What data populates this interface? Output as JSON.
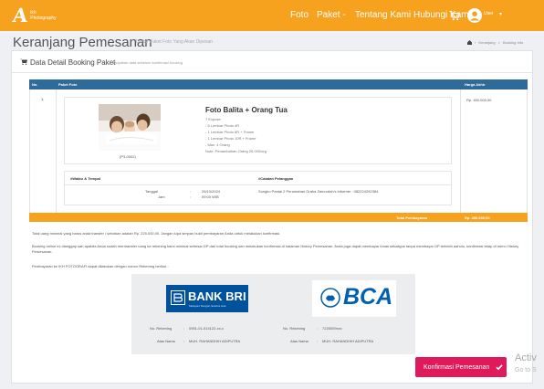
{
  "navbar": {
    "logo_mark": "A",
    "logo_line1": "ikh",
    "logo_line2": "Photography",
    "links": [
      "Foto",
      "Paket -",
      "Tentang Kami",
      "Hubungi Kami"
    ],
    "user_label": "User",
    "caret": "▾",
    "color": "#f6a21e"
  },
  "header": {
    "title": "Keranjang Pemesanan",
    "subtitle": "Daftar Paket Foto Yang Akan Dipesan",
    "breadcrumb": [
      "Keranjang",
      ">",
      "Booking Info"
    ]
  },
  "card": {
    "title": "Data Detail Booking Paket",
    "title_sub": "Lanjutkan data sebelum konfirmasi booking"
  },
  "table": {
    "headers": {
      "no": "No.",
      "paket": "Paket Foto",
      "harga": "Harga Akhir"
    },
    "row": {
      "no": "1.",
      "harga": "Rp. 450.000,00"
    },
    "header_color": "#2e6b9b"
  },
  "package": {
    "code": "(P3-0002)",
    "name": "Foto Balita + Orang Tua",
    "details": [
      "7 Expose",
      "- 5 Lembar Photo 4R",
      "- 1 Lembar Photo 6R + Frame",
      "- 1 Lembar Photo 10R + Frame",
      "- Max. 4 Orang",
      "Note: Penambahan Orang 25.000/org"
    ]
  },
  "schedule": {
    "waktu_header": "#Waktu & Tempat",
    "catatan_header": "#Catatan Pelanggan",
    "tanggal_label": "Tanggal",
    "jam_label": "Jam",
    "separator": ":",
    "tanggal": "26/10/2024",
    "jam": "09:00 WIB",
    "catatan": "Songko Pantai 2 Perumahan Graha Zamrudah's informer : 082224292384"
  },
  "total": {
    "label": "Total Pembayaran",
    "value": "Rp. 450.000,00",
    "color": "#f6a21e"
  },
  "notes": {
    "p1": "Total uang minimal yang harus anda transfer / setorkan adalah Rp. 225.000,00. Jangan lupa simpan bukti pembayaran Anda untuk melakukan konfirmasi.",
    "p2": "Booking online ini dianggap sah apabila Anda sudah mentransfer uang ke rekening kami minimal sebesar DP dari total booking dan melakukan konfirmasi di halaman History Pemesanan. Anda juga dapat membayar lunas sekaligus tanpa membayar DP terlebih dahulu, konfirmasi tetap di menu History Pemesanan.",
    "p3": "Pembayaran ke IKH FOTOGRAFI dapat dilakukan dengan nomor Rekening berikut :"
  },
  "banks": [
    {
      "name": "BANK BRI",
      "tagline": "Melayani Dengan Setulus Hati",
      "rek_label": "No. Rekening",
      "rek": "0951-01-014122-xx-x",
      "nama_label": "Atas Nama",
      "nama": "MUH. RAHANDHIH ADIPUTRA",
      "color": "#00529c"
    },
    {
      "name": "BCA",
      "rek_label": "No. Rekening",
      "rek": "7225009xxx",
      "nama_label": "Atas Nama",
      "nama": "MUH. RAHANDHIH ADIPUTRA",
      "color": "#0060af"
    }
  ],
  "confirm_button": {
    "label": "Konfirmasi Pemesanan",
    "color": "#e0195a"
  },
  "watermark": {
    "line1": "Activ",
    "line2": "Go to S"
  }
}
